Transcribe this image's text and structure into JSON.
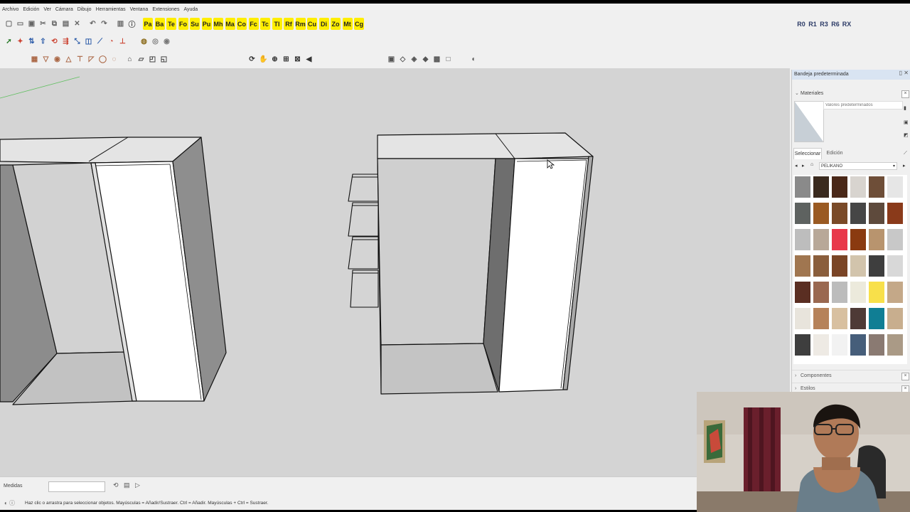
{
  "menu": [
    "Archivo",
    "Edición",
    "Ver",
    "Cámara",
    "Dibujo",
    "Herramientas",
    "Ventana",
    "Extensiones",
    "Ayuda"
  ],
  "toolbar1": {
    "yellow_buttons": [
      "Pa",
      "Ba",
      "Te",
      "Fo",
      "Su",
      "Pu",
      "Mh",
      "Ma",
      "Co",
      "Fc",
      "Tc",
      "Tl",
      "Rf",
      "Rm",
      "Cu",
      "Di",
      "Zo",
      "Mt",
      "Cg"
    ],
    "text_buttons": [
      "R0",
      "R1",
      "R3",
      "R6",
      "RX"
    ]
  },
  "tray": {
    "title": "Bandeja predeterminada",
    "materials_label": "Materiales",
    "material_name_placeholder": "Valores predeterminados",
    "tab_select": "Seleccionar",
    "tab_edit": "Edición",
    "library": "PELIKANO",
    "components_label": "Componentes",
    "styles_label": "Estilos",
    "swatch_colors": [
      [
        "#8a8a8a",
        "#3a2a1e",
        "#4a2818",
        "#d8d4cf",
        "#6e4e38",
        "#e6e6e6"
      ],
      [
        "#5e6260",
        "#9a5a22",
        "#7a4a28",
        "#464646",
        "#5e4a3c",
        "#8a3a1a"
      ],
      [
        "#bdbdbd",
        "#b8a898",
        "#e8384a",
        "#8a3a10",
        "#b8946e",
        "#c8c8c8"
      ],
      [
        "#a07650",
        "#8a5e3c",
        "#7a4526",
        "#d2c4ac",
        "#3e3e3e",
        "#d8d8d8"
      ],
      [
        "#5a2e22",
        "#9a6850",
        "#bcbcbc",
        "#eceadc",
        "#f8e04a",
        "#c4a888"
      ],
      [
        "#e8e4dc",
        "#b6825a",
        "#d8c0a0",
        "#4e3a36",
        "#107e94",
        "#c8ae8e"
      ],
      [
        "#3e3e3e",
        "#eeeae4",
        "#f2f2f2",
        "#465e7a",
        "#8a7a72",
        "#aa9a86"
      ]
    ]
  },
  "status": {
    "measure_label": "Medidas",
    "hint": "Haz clic o arrastra para seleccionar objetos. Mayúsculas = Añadir/Sustraer. Ctrl = Añadir. Mayúsculas + Ctrl = Sustraer."
  },
  "colors": {
    "viewport": "#d4d4d4",
    "toolbar_yellow": "#ffee00",
    "tray_title": "#d9e4f2"
  }
}
